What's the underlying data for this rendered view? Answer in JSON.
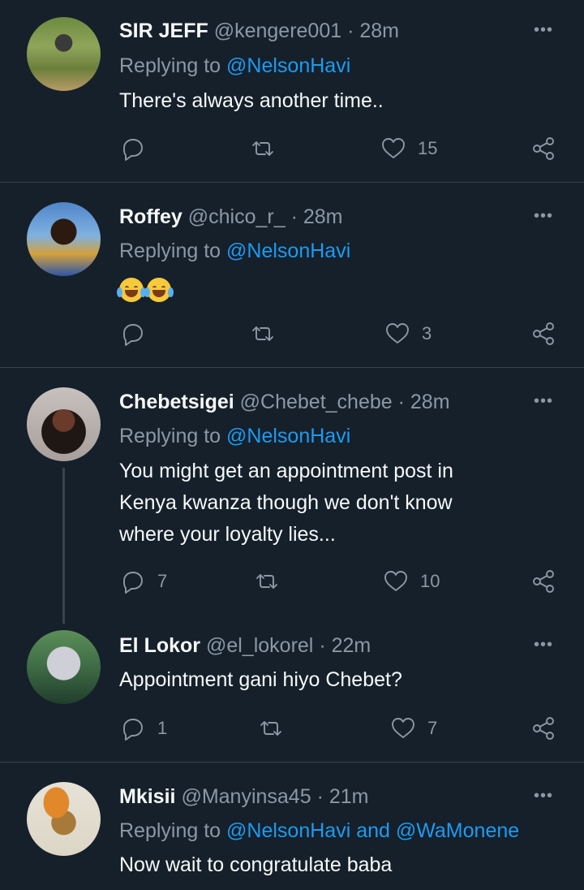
{
  "colors": {
    "background": "#15202b",
    "text": "#f7f9f9",
    "muted": "#8b98a5",
    "link": "#1d9bf0",
    "divider": "#38444d"
  },
  "tweets": [
    {
      "name": "SIR JEFF",
      "handle": "@kengere001",
      "time": "· 28m",
      "reply_prefix": "Replying to ",
      "reply_to": "@NelsonHavi",
      "text": "There's always another time..",
      "reply_count": "",
      "retweet_count": "",
      "like_count": "15"
    },
    {
      "name": "Roffey",
      "handle": "@chico_r_",
      "time": "· 28m",
      "reply_prefix": "Replying to ",
      "reply_to": "@NelsonHavi",
      "emoji": "face-with-tears-of-joy x2",
      "reply_count": "",
      "retweet_count": "",
      "like_count": "3"
    },
    {
      "name": "Chebetsigei",
      "handle": "@Chebet_chebe",
      "time": "· 28m",
      "reply_prefix": "Replying to ",
      "reply_to": "@NelsonHavi",
      "text_lines": [
        "You might get an appointment post in",
        "Kenya kwanza though we don't know",
        "where your loyalty lies..."
      ],
      "reply_count": "7",
      "retweet_count": "",
      "like_count": "10"
    },
    {
      "name": "El Lokor",
      "handle": "@el_lokorel",
      "time": "· 22m",
      "text": "Appointment gani hiyo Chebet?",
      "reply_count": "1",
      "retweet_count": "",
      "like_count": "7"
    },
    {
      "name": "Mkisii",
      "handle": "@Manyinsa45",
      "time": "· 21m",
      "reply_prefix": "Replying to ",
      "reply_to": "@NelsonHavi",
      "reply_and": " and ",
      "reply_to2": "@WaMonene",
      "text": "Now wait to congratulate baba"
    }
  ],
  "more_label": "•••",
  "icons": [
    "reply-icon",
    "retweet-icon",
    "like-icon",
    "share-icon",
    "more-icon"
  ]
}
